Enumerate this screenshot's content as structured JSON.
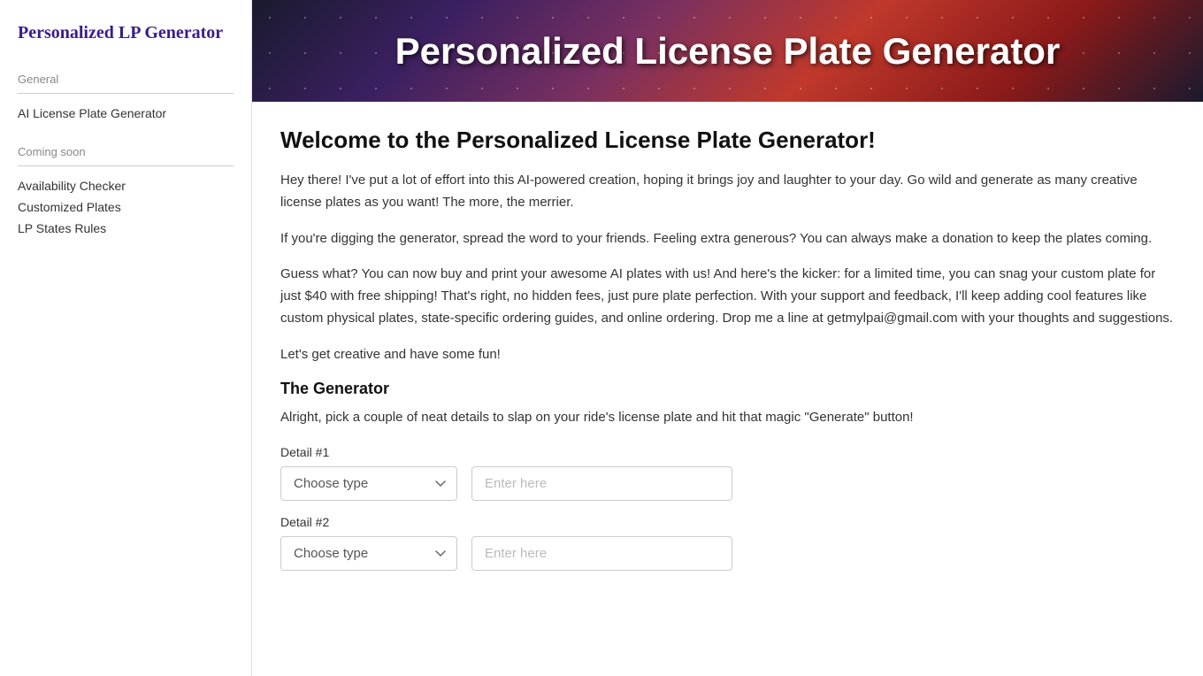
{
  "sidebar": {
    "logo": "Personalized LP Generator",
    "general_section": "General",
    "general_link": "AI License Plate Generator",
    "coming_soon_section": "Coming soon",
    "coming_soon_links": [
      {
        "label": "Availability Checker",
        "id": "availability-checker"
      },
      {
        "label": "Customized Plates",
        "id": "customized-plates"
      },
      {
        "label": "LP States Rules",
        "id": "lp-states-rules"
      }
    ]
  },
  "hero": {
    "title": "Personalized License Plate Generator"
  },
  "content": {
    "welcome_title": "Welcome to the Personalized License Plate Generator!",
    "paragraph1": "Hey there! I've put a lot of effort into this AI-powered creation, hoping it brings joy and laughter to your day. Go wild and generate as many creative license plates as you want! The more, the merrier.",
    "paragraph2": "If you're digging the generator, spread the word to your friends. Feeling extra generous? You can always make a donation to keep the plates coming.",
    "paragraph3": "Guess what? You can now buy and print your awesome AI plates with us! And here's the kicker: for a limited time, you can snag your custom plate for just $40 with free shipping! That's right, no hidden fees, just pure plate perfection. With your support and feedback, I'll keep adding cool features like custom physical plates, state-specific ordering guides, and online ordering. Drop me a line at getmylpai@gmail.com with your thoughts and suggestions.",
    "paragraph4": "Let's get creative and have some fun!",
    "generator_heading": "The Generator",
    "generator_sub": "Alright, pick a couple of neat details to slap on your ride's license plate and hit that magic \"Generate\" button!",
    "detail1_label": "Detail #1",
    "detail2_label": "Detail #2",
    "select_placeholder": "Choose type",
    "input_placeholder": "Enter here"
  }
}
